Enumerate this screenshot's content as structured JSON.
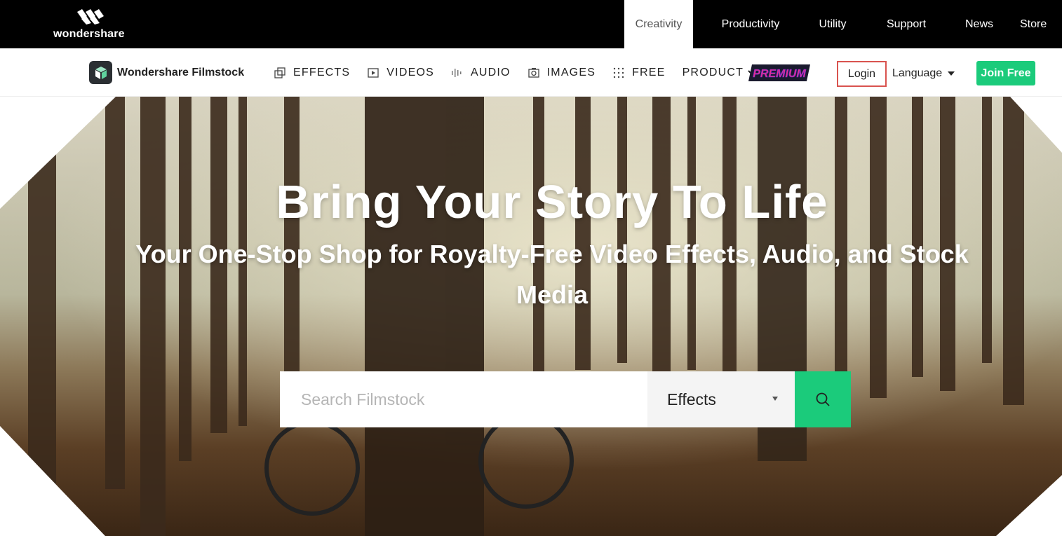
{
  "topbar": {
    "logo_text": "wondershare",
    "tabs": [
      {
        "label": "Creativity",
        "active": true
      },
      {
        "label": "Productivity"
      },
      {
        "label": "Utility"
      },
      {
        "label": "Support"
      },
      {
        "label": "News"
      },
      {
        "label": "Store"
      }
    ]
  },
  "navbar": {
    "brand": "Wondershare Filmstock",
    "items": [
      {
        "label": "EFFECTS",
        "icon": "effects-icon"
      },
      {
        "label": "VIDEOS",
        "icon": "play-icon"
      },
      {
        "label": "AUDIO",
        "icon": "audio-wave-icon"
      },
      {
        "label": "IMAGES",
        "icon": "camera-icon"
      },
      {
        "label": "FREE",
        "icon": "dots-grid-icon"
      },
      {
        "label": "PRODUCT",
        "icon": "chevron-down-icon"
      }
    ],
    "premium_label": "PREMIUM",
    "login_label": "Login",
    "language_label": "Language",
    "join_label": "Join Free"
  },
  "hero": {
    "title": "Bring Your Story To Life",
    "subtitle": "Your One-Stop Shop for Royalty-Free Video Effects, Audio, and Stock Media",
    "search": {
      "placeholder": "Search Filmstock",
      "category": "Effects"
    }
  },
  "colors": {
    "accent_green": "#1bcb7b",
    "login_outline": "#d9534f",
    "premium_pink": "#e8308c"
  }
}
